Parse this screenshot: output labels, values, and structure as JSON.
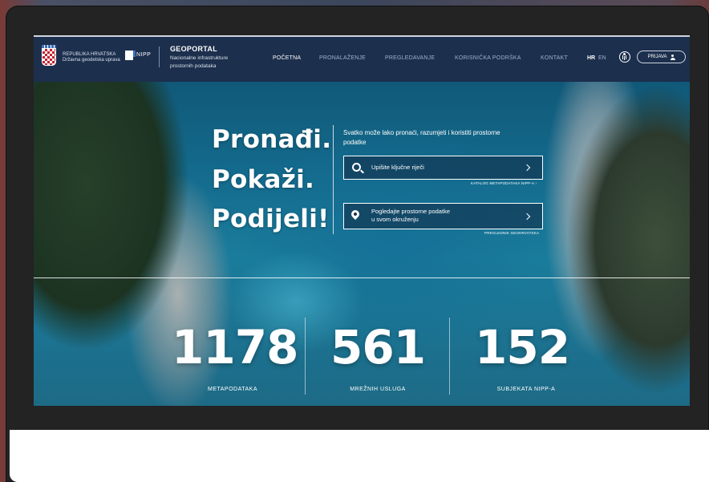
{
  "brand": {
    "country_line1": "REPUBLIKA HRVATSKA",
    "country_line2": "Državna geodetska uprava",
    "nipp": "NIPP",
    "title": "GEOPORTAL",
    "subtitle": "Nacionalne infrastrukture prostornih podataka"
  },
  "nav": {
    "items": [
      "POČETNA",
      "PRONALAŽENJE",
      "PREGLEDAVANJE",
      "KORISNIČKA PODRŠKA",
      "KONTAKT"
    ],
    "active": "POČETNA",
    "lang_hr": "HR",
    "lang_en": "EN",
    "login": "PRIJAVA"
  },
  "hero": {
    "line1": "Pronađi.",
    "line2": "Pokaži.",
    "line3": "Podijeli!",
    "description": "Svatko može lako pronaći, razumjeti i koristiti prostorne podatke",
    "search_placeholder": "Upišite ključne riječi",
    "search_link": "KATALOG METAPODATAKA NIPP-A ›",
    "view_line1": "Pogledajte prostorne podatke",
    "view_line2": "u svom okruženju",
    "view_link": "PREGLEDNIK GEOHRVATSKA"
  },
  "stats": [
    {
      "value": "1178",
      "label": "METAPODATAKA"
    },
    {
      "value": "561",
      "label": "MREŽNIH USLUGA"
    },
    {
      "value": "152",
      "label": "SUBJEKATA NIPP-A"
    }
  ],
  "colors": {
    "navbar": "#1c2f4d",
    "monitor": "#232323",
    "sea": "#13698b"
  }
}
